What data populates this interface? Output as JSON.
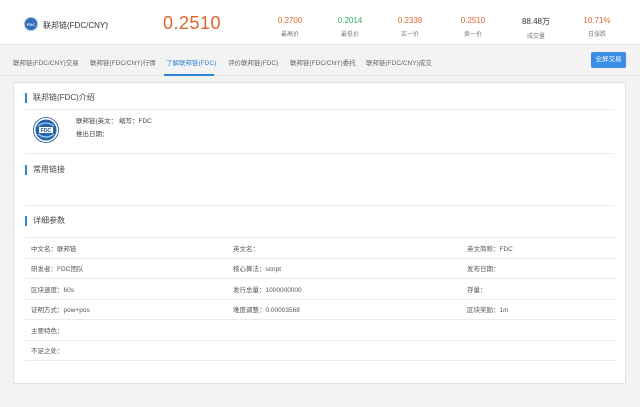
{
  "header": {
    "logo_text": "FDC",
    "pair": "联邦链(FDC/CNY)",
    "caret": "⌄",
    "price": "0.2510",
    "stats": [
      {
        "value": "0.2700",
        "label": "最高价",
        "color": "red"
      },
      {
        "value": "0.2014",
        "label": "最低价",
        "color": "green"
      },
      {
        "value": "0.2339",
        "label": "买一价",
        "color": "red"
      },
      {
        "value": "0.2510",
        "label": "卖一价",
        "color": "red"
      },
      {
        "value": "88.48万",
        "label": "成交量",
        "color": "dark"
      },
      {
        "value": "10.71%",
        "label": "日涨跌",
        "color": "red"
      }
    ]
  },
  "tabs": [
    {
      "label": "联邦链(FDC/CNY)交易"
    },
    {
      "label": "联邦链(FDC/CNY)行情"
    },
    {
      "label": "了解联邦链(FDC)"
    },
    {
      "label": "评价联邦链(FDC)"
    },
    {
      "label": "联邦链(FDC/CNY)委托"
    },
    {
      "label": "联邦链(FDC/CNY)成交"
    }
  ],
  "active_tab": 2,
  "fullscreen_label": "全屏交易",
  "intro": {
    "title": "联邦链(FDC)介绍",
    "logo_text": "FDC",
    "line1": "联邦链(英文： 缩写：FDC",
    "line2": "推出日期："
  },
  "links": {
    "title": "常用链接"
  },
  "params": {
    "title": "详细参数",
    "rows": [
      [
        "中文名：联邦链",
        "英文名：",
        "英文简称：FDC"
      ],
      [
        "研发者：FDC团队",
        "核心算法：script",
        "发布日期："
      ],
      [
        "区块速度：60s",
        "发行总量：1000000000",
        "存量："
      ],
      [
        "证明方式：pow+pos",
        "难度调整：0.00003568",
        "区块奖励：1m"
      ],
      [
        "主要特色：",
        "",
        ""
      ],
      [
        "不足之处：",
        "",
        ""
      ]
    ]
  },
  "colors": {
    "accent": "#2e86d6",
    "price_red": "#e0662c",
    "price_green": "#3aa86b"
  }
}
